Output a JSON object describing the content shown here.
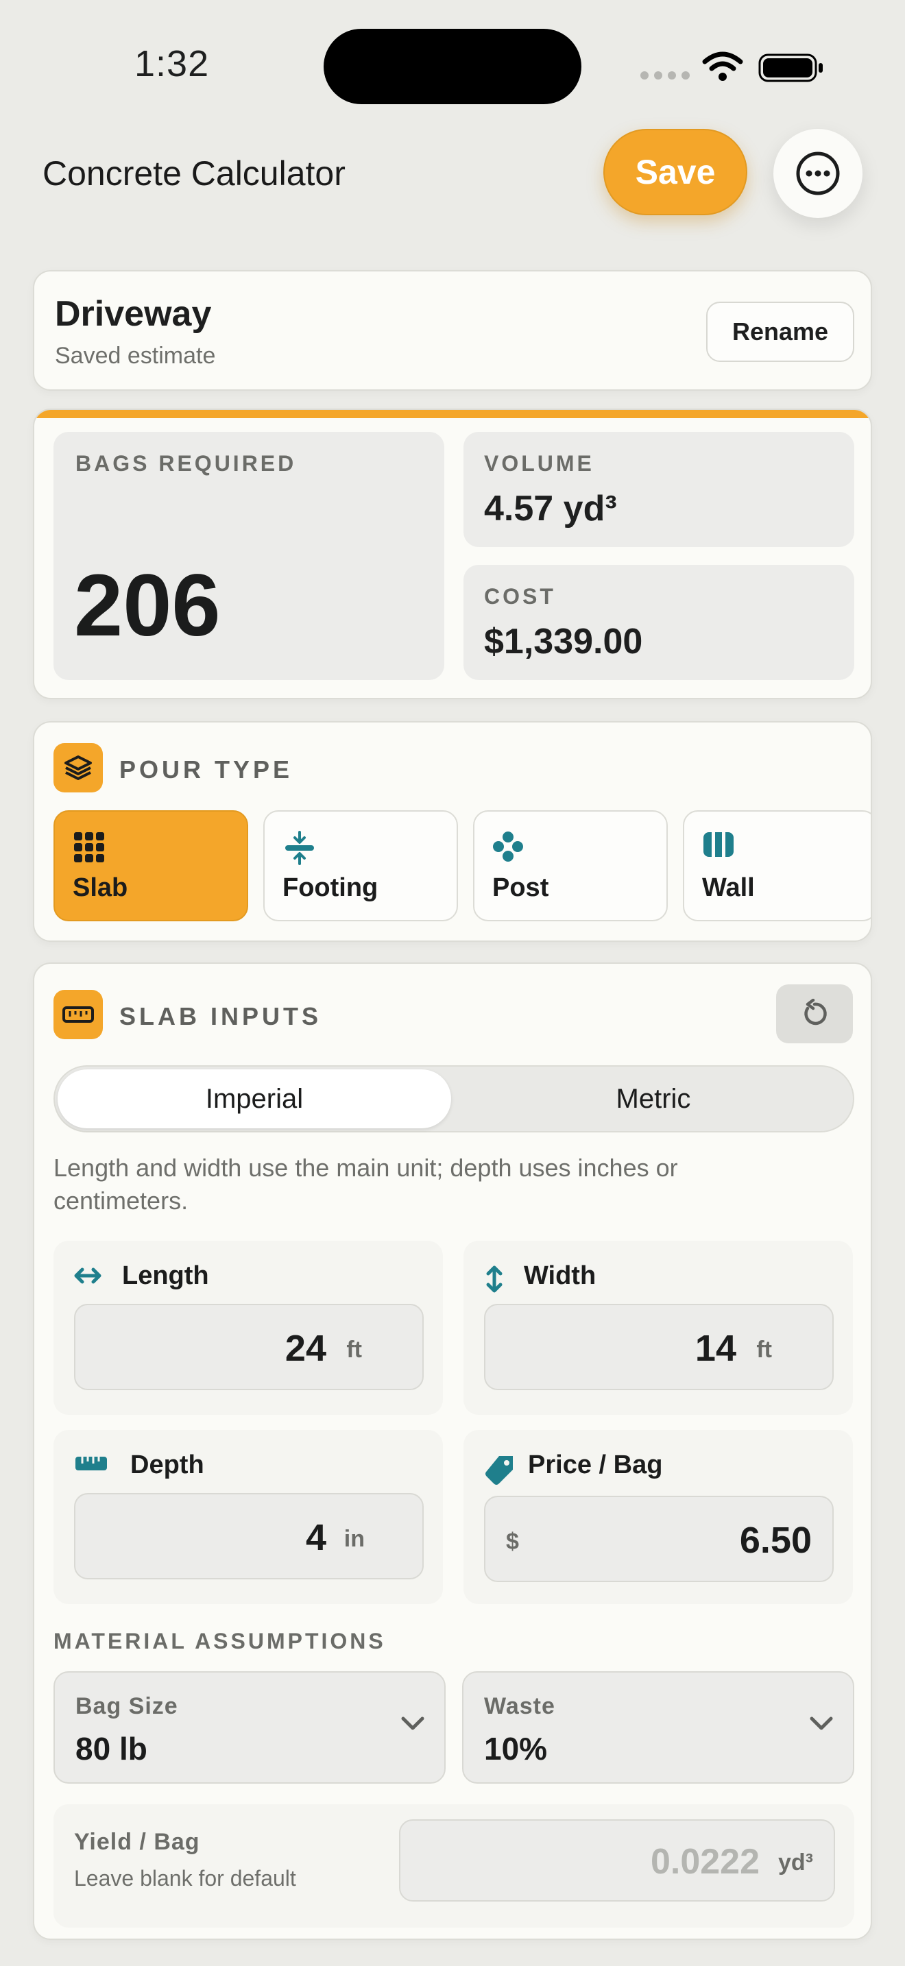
{
  "status_bar": {
    "time": "1:32"
  },
  "header": {
    "title": "Concrete Calculator",
    "save_label": "Save"
  },
  "estimate": {
    "name": "Driveway",
    "subtitle": "Saved estimate",
    "rename_label": "Rename"
  },
  "results": {
    "bags_label": "BAGS REQUIRED",
    "bags_value": "206",
    "volume_label": "VOLUME",
    "volume_value": "4.57 yd³",
    "cost_label": "COST",
    "cost_value": "$1,339.00"
  },
  "pour_type": {
    "label": "POUR TYPE",
    "options": [
      {
        "label": "Slab",
        "icon": "grid-icon",
        "selected": true
      },
      {
        "label": "Footing",
        "icon": "footing-icon",
        "selected": false
      },
      {
        "label": "Post",
        "icon": "post-icon",
        "selected": false
      },
      {
        "label": "Wall",
        "icon": "wall-icon",
        "selected": false
      }
    ]
  },
  "inputs": {
    "label": "SLAB INPUTS",
    "unit_system": {
      "options": [
        "Imperial",
        "Metric"
      ],
      "selected": "Imperial"
    },
    "hint": "Length and width use the main unit; depth uses inches or centimeters.",
    "length": {
      "label": "Length",
      "value": "24",
      "unit": "ft"
    },
    "width": {
      "label": "Width",
      "value": "14",
      "unit": "ft"
    },
    "depth": {
      "label": "Depth",
      "value": "4",
      "unit": "in"
    },
    "price": {
      "label": "Price / Bag",
      "prefix": "$",
      "value": "6.50"
    }
  },
  "material": {
    "label": "MATERIAL ASSUMPTIONS",
    "bag_size": {
      "label": "Bag Size",
      "value": "80 lb"
    },
    "waste": {
      "label": "Waste",
      "value": "10%"
    },
    "yield": {
      "label": "Yield / Bag",
      "hint": "Leave blank for default",
      "placeholder": "0.0222",
      "unit": "yd³"
    }
  },
  "colors": {
    "accent": "#f4a62a",
    "teal": "#1f7f8c",
    "background": "#ebebe7"
  }
}
